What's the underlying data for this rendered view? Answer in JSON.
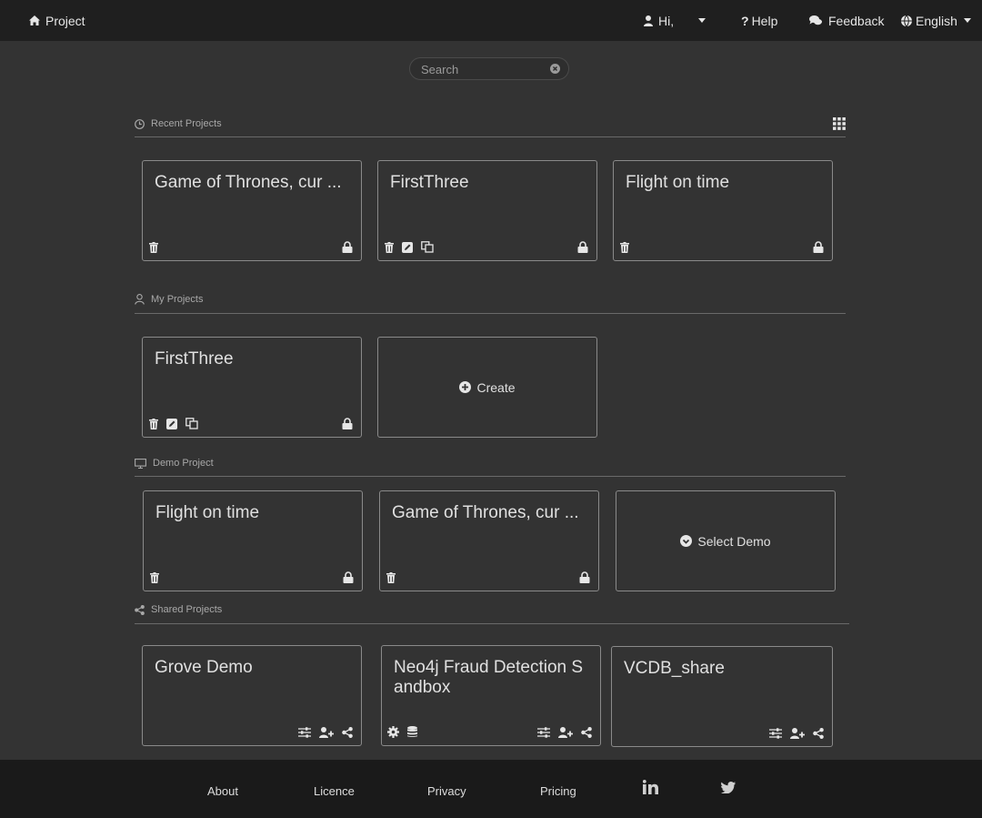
{
  "nav": {
    "project": "Project",
    "greeting": "Hi,",
    "help": "Help",
    "feedback": "Feedback",
    "language": "English"
  },
  "search": {
    "placeholder": "Search"
  },
  "sections": {
    "recent": "Recent Projects",
    "mine": "My Projects",
    "demo": "Demo Project",
    "shared": "Shared Projects"
  },
  "recent_projects": [
    {
      "title": "Game of Thrones, cur ..."
    },
    {
      "title": "FirstThree"
    },
    {
      "title": "Flight on time"
    }
  ],
  "my_projects": [
    {
      "title": "FirstThree"
    }
  ],
  "create_label": "Create",
  "demo_projects": [
    {
      "title": "Flight on time"
    },
    {
      "title": "Game of Thrones, cur ..."
    }
  ],
  "select_demo_label": "Select Demo",
  "shared_projects": [
    {
      "title": "Grove Demo"
    },
    {
      "title": "Neo4j Fraud Detection Sandbox"
    },
    {
      "title": "VCDB_share"
    }
  ],
  "footer": {
    "about": "About",
    "licence": "Licence",
    "privacy": "Privacy",
    "pricing": "Pricing"
  }
}
